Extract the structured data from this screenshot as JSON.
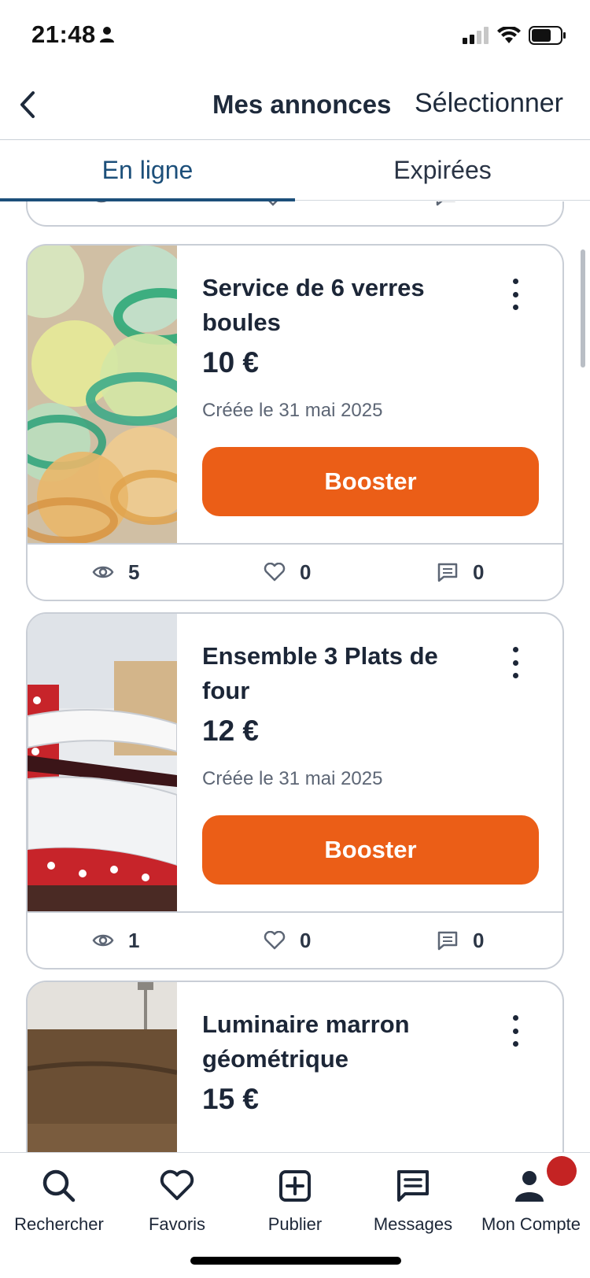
{
  "status_bar": {
    "time": "21:48"
  },
  "header": {
    "title": "Mes annonces",
    "select_label": "Sélectionner"
  },
  "tabs": [
    {
      "label": "En ligne",
      "active": true
    },
    {
      "label": "Expirées",
      "active": false
    }
  ],
  "listings": [
    {
      "title": "Service de 6 verres boules",
      "price": "10 €",
      "created": "Créée le 31 mai 2025",
      "boost_label": "Booster",
      "views": "5",
      "likes": "0",
      "messages": "0"
    },
    {
      "title": "Ensemble 3 Plats de four",
      "price": "12 €",
      "created": "Créée le 31 mai 2025",
      "boost_label": "Booster",
      "views": "1",
      "likes": "0",
      "messages": "0"
    },
    {
      "title": "Luminaire marron géométrique",
      "price": "15 €"
    }
  ],
  "bottom_nav": [
    {
      "label": "Rechercher",
      "icon": "search-icon"
    },
    {
      "label": "Favoris",
      "icon": "heart-icon"
    },
    {
      "label": "Publier",
      "icon": "plus-square-icon"
    },
    {
      "label": "Messages",
      "icon": "message-icon"
    },
    {
      "label": "Mon Compte",
      "icon": "account-icon"
    }
  ],
  "colors": {
    "accent": "#eb5e17",
    "tab_active": "#1c4f7a",
    "text": "#1c2637",
    "notification": "#c42323"
  }
}
